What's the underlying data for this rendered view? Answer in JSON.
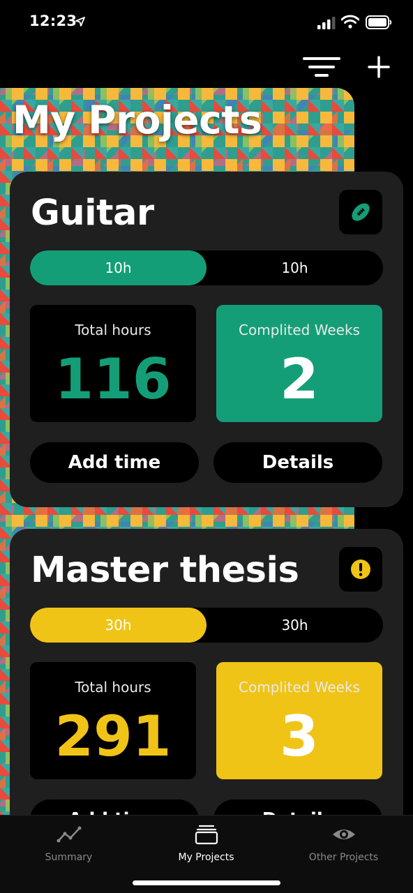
{
  "status_bar": {
    "time": "12:23"
  },
  "page": {
    "title": "My Projects"
  },
  "colors": {
    "green": "#149e77",
    "yellow": "#f0c417",
    "card_bg": "#1f1f1f"
  },
  "projects": [
    {
      "name": "Guitar",
      "icon": "football-icon",
      "accent": "#149e77",
      "progress_fraction": 0.5,
      "progress_done_label": "10h",
      "progress_goal_label": "10h",
      "total_hours_label": "Total hours",
      "total_hours": "116",
      "weeks_label": "Complited Weeks",
      "weeks": "2",
      "add_time_label": "Add time",
      "details_label": "Details"
    },
    {
      "name": "Master thesis",
      "icon": "exclamation-icon",
      "accent": "#f0c417",
      "progress_fraction": 0.5,
      "progress_done_label": "30h",
      "progress_goal_label": "30h",
      "total_hours_label": "Total hours",
      "total_hours": "291",
      "weeks_label": "Complited Weeks",
      "weeks": "3",
      "add_time_label": "Add time",
      "details_label": "Details"
    }
  ],
  "tabs": [
    {
      "label": "Summary",
      "icon": "chart-line-icon",
      "active": false
    },
    {
      "label": "My Projects",
      "icon": "stack-icon",
      "active": true
    },
    {
      "label": "Other Projects",
      "icon": "eye-icon",
      "active": false
    }
  ]
}
